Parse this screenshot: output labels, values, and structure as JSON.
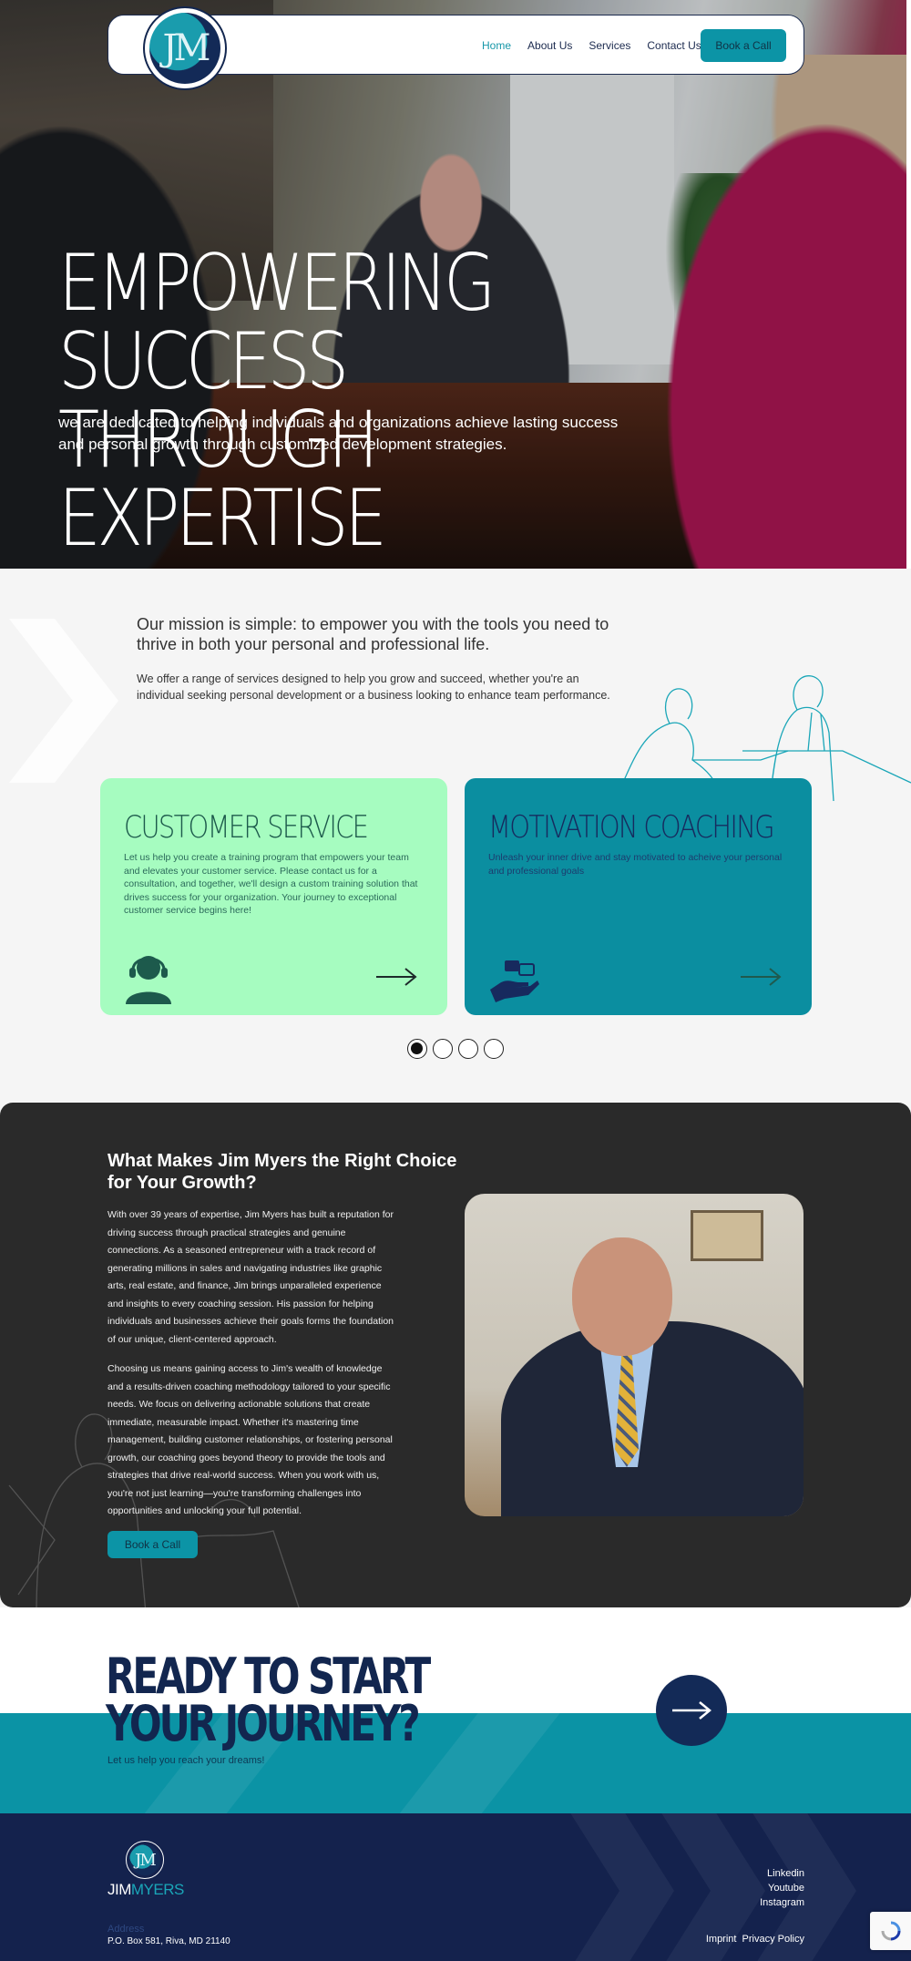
{
  "nav": {
    "logo_text": "JM",
    "links": [
      {
        "label": "Home",
        "active": true
      },
      {
        "label": "About Us",
        "active": false
      },
      {
        "label": "Services",
        "active": false
      },
      {
        "label": "Contact Us",
        "active": false
      }
    ],
    "cta_label": "Book a Call"
  },
  "hero": {
    "title_line1": "EMPOWERING SUCCESS",
    "title_line2": "THROUGH EXPERTISE",
    "subtitle": "we are dedicated to helping individuals and organizations achieve lasting success and personal growth through customized development strategies."
  },
  "mission": {
    "lead": "Our mission is simple: to empower you with the tools you need to thrive in both your personal and professional life.",
    "body": "We offer a range of services designed to help you grow and succeed, whether you're an individual seeking personal development or a business looking to enhance team performance."
  },
  "services": [
    {
      "title": "CUSTOMER SERVICE",
      "text": "Let us help you create a training program that empowers your team and elevates your customer service. Please contact us for a consultation, and together, we'll design a custom training solution that drives success for your organization. Your journey to exceptional customer service begins here!",
      "icon": "headset-agent-icon"
    },
    {
      "title": "MOTIVATION COACHING",
      "text": "Unleash your inner drive and stay motivated to acheive your personal and professional goals",
      "icon": "hand-holding-stars-icon"
    }
  ],
  "carousel": {
    "count": 4,
    "active_index": 0
  },
  "about": {
    "title": "What Makes Jim Myers the Right Choice for Your Growth?",
    "para1": "With over 39 years of expertise, Jim Myers has built a reputation for driving success through practical strategies and genuine connections. As a seasoned entrepreneur with a track record of generating millions in sales and navigating industries like graphic arts, real estate, and finance, Jim brings unparalleled experience and insights to every coaching session. His passion for helping individuals and businesses achieve their goals forms the foundation of our unique, client-centered approach.",
    "para2": "Choosing us means gaining access to Jim's wealth of knowledge and a results-driven coaching methodology tailored to your specific needs. We focus on delivering actionable solutions that create immediate, measurable impact. Whether it's mastering time management, building customer relationships, or fostering personal growth, our coaching goes beyond theory to provide the tools and strategies that drive real-world success. When you work with us, you're not just learning—you're transforming challenges into opportunities and unlocking your full potential.",
    "cta_label": "Book a Call"
  },
  "cta": {
    "title_line1": "READY TO START",
    "title_line2": "YOUR JOURNEY?",
    "subtitle": "Let us help you reach your dreams!"
  },
  "footer": {
    "logo_mark": "JM",
    "brand_first": "JIM",
    "brand_last": "MYERS",
    "address_label": "Address",
    "address": "P.O. Box 581, Riva, MD 21140",
    "social": [
      "Linkedin",
      "Youtube",
      "Instagram"
    ],
    "legal": [
      "Imprint",
      "Privacy Policy"
    ]
  },
  "colors": {
    "teal": "#0b93a5",
    "navy": "#14224d",
    "mint": "#a6fcc0",
    "dark": "#2a2a2a"
  }
}
